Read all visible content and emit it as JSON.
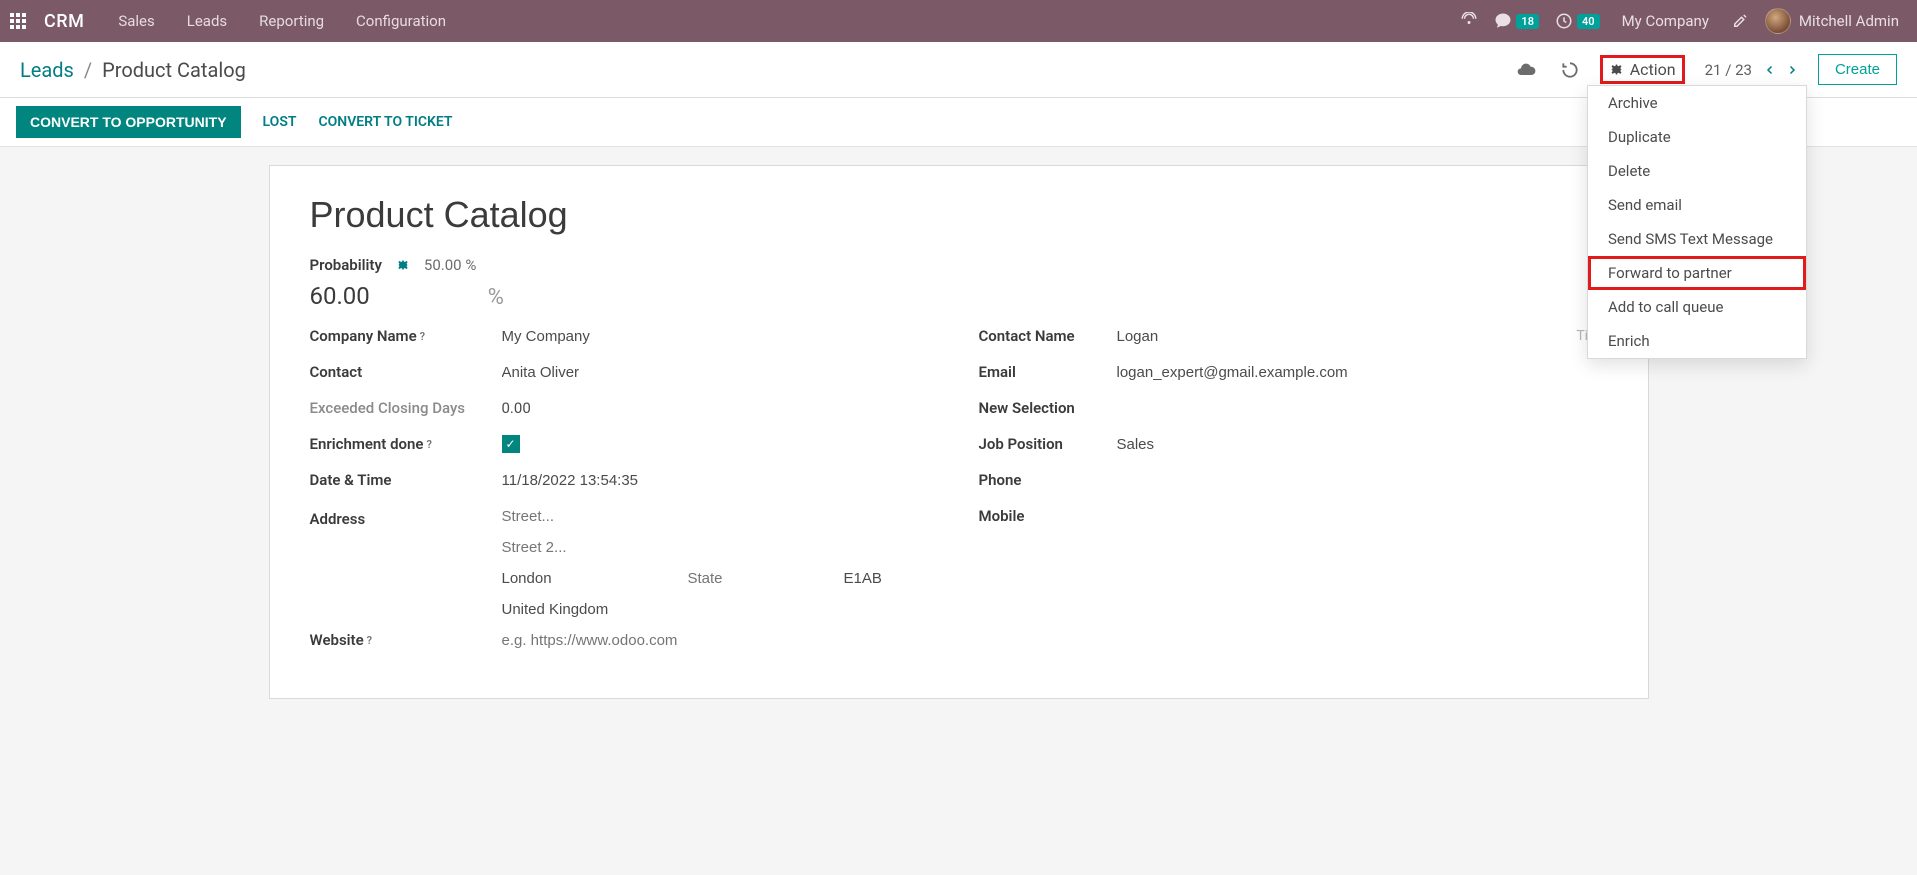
{
  "brand": "CRM",
  "nav": {
    "links": [
      "Sales",
      "Leads",
      "Reporting",
      "Configuration"
    ]
  },
  "navbar_right": {
    "messages_badge": "18",
    "activities_badge": "40",
    "company": "My Company",
    "user_name": "Mitchell Admin"
  },
  "breadcrumb": {
    "parent": "Leads",
    "current": "Product Catalog"
  },
  "action_button": "Action",
  "pager": {
    "text": "21 / 23"
  },
  "create_label": "Create",
  "button_bar": {
    "convert_opportunity": "CONVERT TO OPPORTUNITY",
    "lost": "LOST",
    "convert_ticket": "CONVERT TO TICKET"
  },
  "dropdown_items": [
    "Archive",
    "Duplicate",
    "Delete",
    "Send email",
    "Send SMS Text Message",
    "Forward to partner",
    "Add to call queue",
    "Enrich"
  ],
  "form": {
    "title": "Product Catalog",
    "probability_label": "Probability",
    "probability_pct_text": "50.00 %",
    "probability_value": "60.00",
    "labels": {
      "company": "Company Name",
      "contact": "Contact",
      "exceeded": "Exceeded Closing Days",
      "enrichment": "Enrichment done",
      "datetime": "Date & Time",
      "address": "Address",
      "website": "Website",
      "contact_name": "Contact Name",
      "email": "Email",
      "new_selection": "New Selection",
      "job_position": "Job Position",
      "phone": "Phone",
      "mobile": "Mobile",
      "title": "Title"
    },
    "values": {
      "company": "My Company",
      "contact": "Anita Oliver",
      "exceeded": "0.00",
      "datetime": "11/18/2022 13:54:35",
      "city": "London",
      "zip": "E1AB",
      "country": "United Kingdom",
      "contact_name": "Logan",
      "email": "logan_expert@gmail.example.com",
      "job_position": "Sales"
    },
    "placeholders": {
      "street": "Street...",
      "street2": "Street 2...",
      "state": "State",
      "website": "e.g. https://www.odoo.com"
    }
  }
}
